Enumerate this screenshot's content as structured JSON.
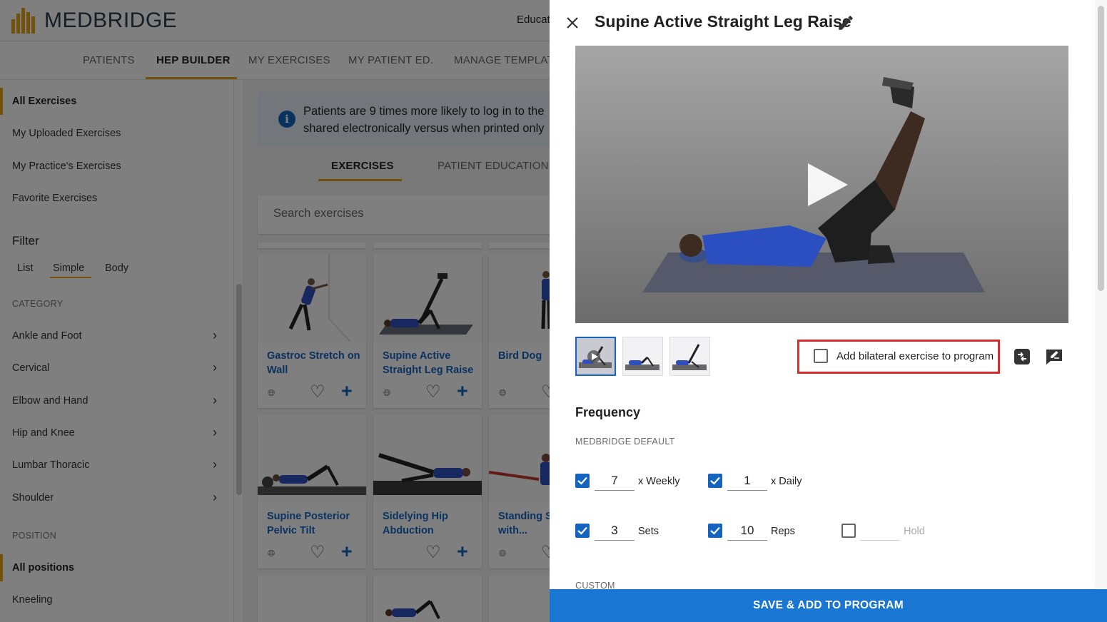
{
  "app": {
    "logo_text": "MEDBRIDGE",
    "top_right_text": "Educat"
  },
  "nav": {
    "items": [
      "PATIENTS",
      "HEP BUILDER",
      "MY EXERCISES",
      "MY PATIENT ED.",
      "MANAGE TEMPLAT"
    ],
    "active": "HEP BUILDER"
  },
  "sidebar": {
    "library_items": [
      "All Exercises",
      "My Uploaded Exercises",
      "My Practice's Exercises",
      "Favorite Exercises"
    ],
    "filter_title": "Filter",
    "filter_tabs": [
      "List",
      "Simple",
      "Body"
    ],
    "category_heading": "CATEGORY",
    "categories": [
      "Ankle and Foot",
      "Cervical",
      "Elbow and Hand",
      "Hip and Knee",
      "Lumbar Thoracic",
      "Shoulder"
    ],
    "position_heading": "POSITION",
    "positions": [
      "All positions",
      "Kneeling"
    ]
  },
  "main": {
    "info_line1": "Patients are 9 times more likely to log in to the",
    "info_line2": "shared electronically versus when printed only",
    "tabs": [
      "EXERCISES",
      "PATIENT EDUCATION"
    ],
    "search_placeholder": "Search exercises",
    "cards": [
      {
        "title": "Gastroc Stretch on Wall"
      },
      {
        "title": "Supine Active Straight Leg Raise"
      },
      {
        "title": "Bird Dog"
      },
      {
        "title": "Supine Posterior Pelvic Tilt"
      },
      {
        "title": "Sidelying Hip Abduction"
      },
      {
        "title": "Standing S Row with..."
      }
    ]
  },
  "panel": {
    "title": "Supine Active Straight Leg Raise",
    "bilateral_label": "Add bilateral exercise to program",
    "frequency_title": "Frequency",
    "frequency_sub": "MEDBRIDGE DEFAULT",
    "weekly_value": "7",
    "weekly_label": "x Weekly",
    "daily_value": "1",
    "daily_label": "x Daily",
    "sets_value": "3",
    "sets_label": "Sets",
    "reps_value": "10",
    "reps_label": "Reps",
    "hold_value": "",
    "hold_label": "Hold",
    "custom_label": "CUSTOM",
    "save_button": "SAVE & ADD TO PROGRAM"
  },
  "colors": {
    "accent": "#e8a317",
    "primary": "#1976d2",
    "link": "#1565c0",
    "highlight": "#d32f2f"
  },
  "icons": [
    "close-icon",
    "edit-icon",
    "play-icon",
    "swap-icon",
    "note-icon",
    "info-icon",
    "globe-icon",
    "heart-icon",
    "plus-icon",
    "chevron-right-icon",
    "checkmark-icon"
  ]
}
